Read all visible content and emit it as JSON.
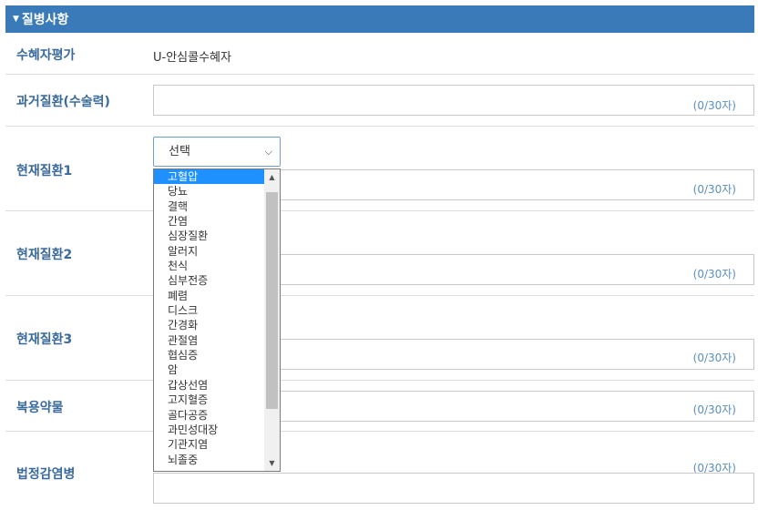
{
  "section": {
    "title": "질병사항"
  },
  "rows": {
    "recipient_eval": {
      "label": "수혜자평가",
      "value": "U-안심콜수혜자"
    },
    "past_disease": {
      "label": "과거질환(수술력)",
      "counter": "(0/30자)"
    },
    "current_1": {
      "label": "현재질환1",
      "counter": "(0/30자)"
    },
    "current_2": {
      "label": "현재질환2",
      "counter": "(0/30자)"
    },
    "current_3": {
      "label": "현재질환3",
      "counter": "(0/30자)"
    },
    "medication": {
      "label": "복용약물",
      "counter": "(0/30자)"
    },
    "infectious": {
      "label": "법정감염병",
      "counter": "(0/30자)"
    }
  },
  "select": {
    "selected": "선택",
    "options": [
      "고혈압",
      "당뇨",
      "결핵",
      "간염",
      "심장질환",
      "알러지",
      "천식",
      "심부전증",
      "폐렴",
      "디스크",
      "간경화",
      "관절염",
      "협심증",
      "암",
      "갑상선염",
      "고지혈증",
      "골다공증",
      "과민성대장",
      "기관지염",
      "뇌졸중"
    ],
    "highlighted_index": 0
  }
}
